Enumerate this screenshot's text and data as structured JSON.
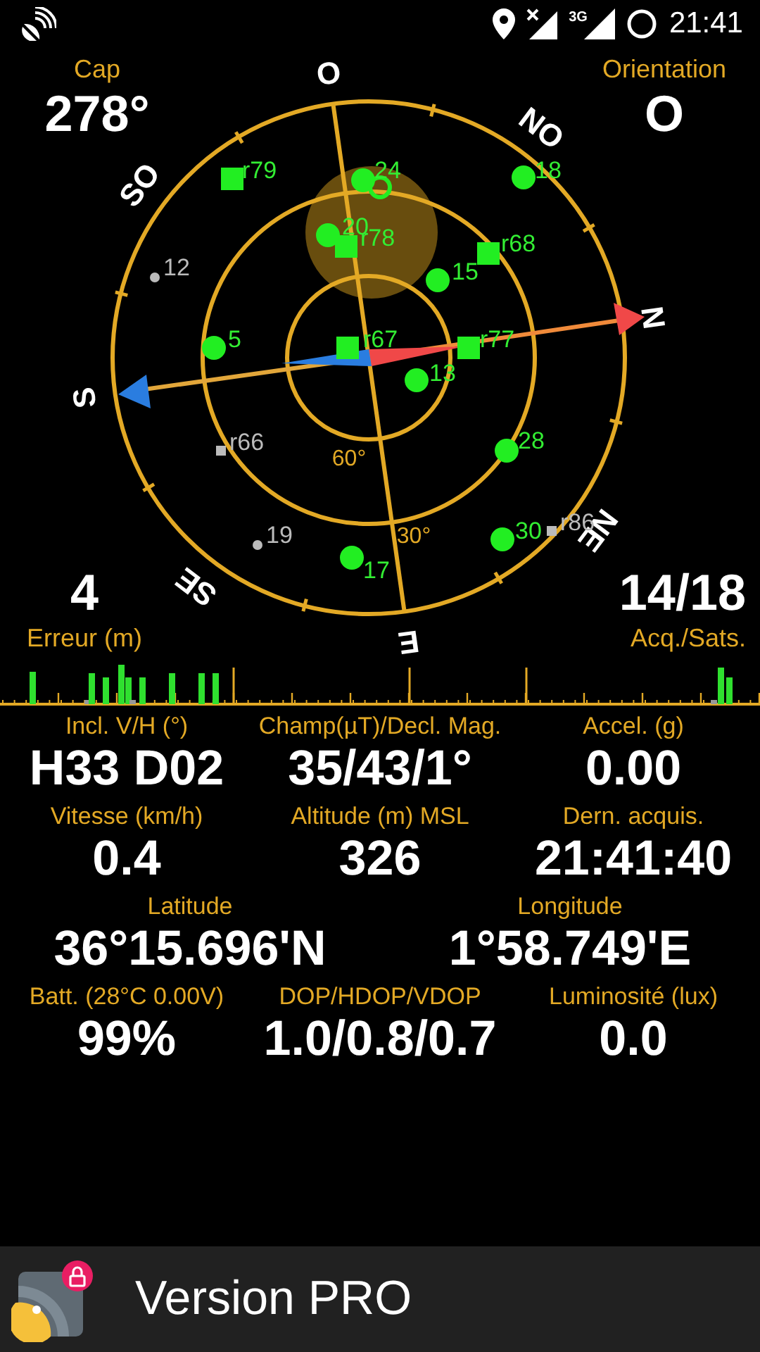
{
  "status_bar": {
    "network": "3G",
    "time": "21:41"
  },
  "heading": {
    "label": "Cap",
    "value": "278°"
  },
  "orientation": {
    "label": "Orientation",
    "value": "O"
  },
  "error": {
    "label": "Erreur (m)",
    "value": "4"
  },
  "satellite_count": {
    "label": "Acq./Sats.",
    "value": "14/18"
  },
  "compass_labels": [
    "O",
    "NO",
    "N",
    "NE",
    "E",
    "SE",
    "S",
    "SO"
  ],
  "elevation_labels": [
    "60°",
    "30°"
  ],
  "satellites": [
    {
      "label": "r79",
      "kind": "square",
      "used": true
    },
    {
      "label": "24",
      "kind": "circle",
      "used": true
    },
    {
      "label": "18",
      "kind": "circle",
      "used": true
    },
    {
      "label": "12",
      "kind": "circle",
      "used": false
    },
    {
      "label": "20",
      "kind": "circle",
      "used": true
    },
    {
      "label": "r78",
      "kind": "square",
      "used": true
    },
    {
      "label": "r68",
      "kind": "square",
      "used": true
    },
    {
      "label": "15",
      "kind": "circle",
      "used": true
    },
    {
      "label": "5",
      "kind": "circle",
      "used": true
    },
    {
      "label": "r67",
      "kind": "square",
      "used": true
    },
    {
      "label": "r77",
      "kind": "square",
      "used": true
    },
    {
      "label": "13",
      "kind": "circle",
      "used": true
    },
    {
      "label": "r66",
      "kind": "square",
      "used": false
    },
    {
      "label": "28",
      "kind": "circle",
      "used": true
    },
    {
      "label": "19",
      "kind": "circle",
      "used": false
    },
    {
      "label": "17",
      "kind": "circle",
      "used": true
    },
    {
      "label": "30",
      "kind": "circle",
      "used": true
    },
    {
      "label": "r86",
      "kind": "square",
      "used": false
    }
  ],
  "readings": [
    [
      {
        "label": "Incl. V/H (°)",
        "value": "H33 D02"
      },
      {
        "label": "Champ(µT)/Decl. Mag.",
        "value": "35/43/1°"
      },
      {
        "label": "Accel. (g)",
        "value": "0.00"
      }
    ],
    [
      {
        "label": "Vitesse (km/h)",
        "value": "0.4"
      },
      {
        "label": "Altitude (m) MSL",
        "value": "326"
      },
      {
        "label": "Dern. acquis.",
        "value": "21:41:40"
      }
    ],
    [
      {
        "label": "Latitude",
        "value": "36°15.696'N"
      },
      {
        "label": "Longitude",
        "value": "1°58.749'E"
      }
    ],
    [
      {
        "label": "Batt. (28°C 0.00V)",
        "value": "99%"
      },
      {
        "label": "DOP/HDOP/VDOP",
        "value": "1.0/0.8/0.7"
      },
      {
        "label": "Luminosité (lux)",
        "value": "0.0"
      }
    ]
  ],
  "footer": {
    "label": "Version PRO"
  }
}
